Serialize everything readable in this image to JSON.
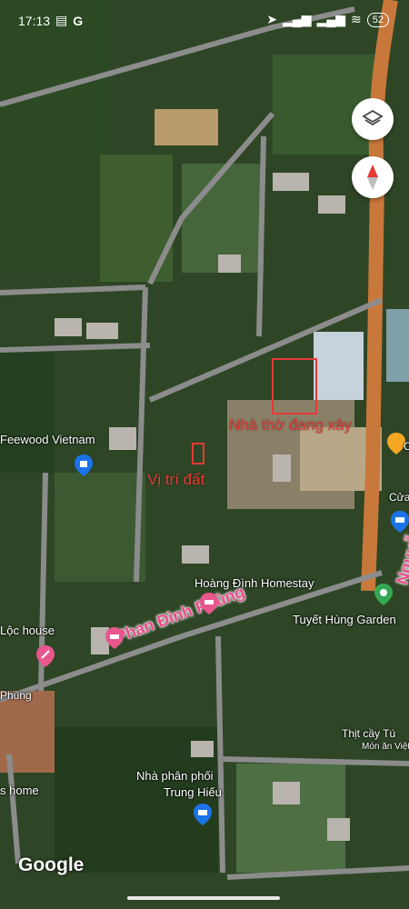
{
  "status_bar": {
    "time": "17:13",
    "battery": "52"
  },
  "annotations": {
    "building_label": "Nhà thờ đang xây",
    "plot_label": "Vị trí đất"
  },
  "roads": {
    "phan_dinh_phung": "Phan Đình Phùng",
    "nguyen_tri_phuong": "Nguyễn Tri Phương",
    "phung_partial": "Phùng"
  },
  "places": {
    "feewood": "Feewood Vietnam",
    "hoang_dinh": "Hoàng Đình Homestay",
    "tuyet_hung": "Tuyết Hùng Garden",
    "loc_house": "Lộc house",
    "thit_cay": "Thịt cầy Tú",
    "mon_an": "Món ăn Việt",
    "npp_line1": "Nhà phân phối",
    "npp_line2": "Trung Hiếu",
    "home_partial": "s home",
    "cua_partial": "Cửa",
    "c_partial": "C"
  },
  "branding": {
    "logo": "Google"
  },
  "icons": {
    "layers": "layers-icon",
    "compass": "compass-icon"
  },
  "colors": {
    "annotation_red": "#e53935",
    "road_label": "#e94b8a"
  }
}
